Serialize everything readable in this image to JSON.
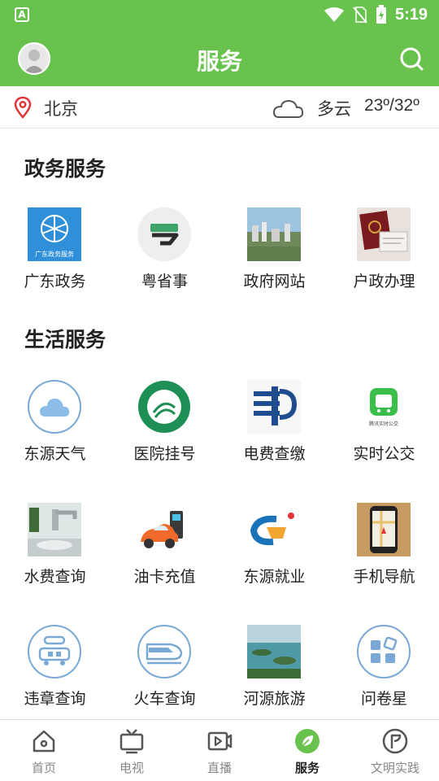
{
  "status": {
    "time": "5:19"
  },
  "header": {
    "title": "服务"
  },
  "weather": {
    "city": "北京",
    "condition": "多云",
    "temperature": "23º/32º"
  },
  "gov": {
    "title": "政务服务",
    "items": [
      {
        "label": "广东政务",
        "icon": "guangdong-gov-icon",
        "caption": "广东政务服务"
      },
      {
        "label": "粤省事",
        "icon": "yueshengshi-icon"
      },
      {
        "label": "政府网站",
        "icon": "city-photo-icon"
      },
      {
        "label": "户政办理",
        "icon": "passport-photo-icon"
      }
    ]
  },
  "life": {
    "title": "生活服务",
    "items": [
      {
        "label": "东源天气",
        "icon": "cloud-icon"
      },
      {
        "label": "医院挂号",
        "icon": "hospital-logo-icon"
      },
      {
        "label": "电费查缴",
        "icon": "power-grid-logo-icon"
      },
      {
        "label": "实时公交",
        "icon": "bus-app-icon",
        "caption": "腾讯实时公交"
      },
      {
        "label": "水费查询",
        "icon": "faucet-photo-icon"
      },
      {
        "label": "油卡充值",
        "icon": "car-fuel-icon"
      },
      {
        "label": "东源就业",
        "icon": "employment-logo-icon"
      },
      {
        "label": "手机导航",
        "icon": "phone-map-icon"
      },
      {
        "label": "违章查询",
        "icon": "traffic-car-icon"
      },
      {
        "label": "火车查询",
        "icon": "train-icon"
      },
      {
        "label": "河源旅游",
        "icon": "lake-photo-icon"
      },
      {
        "label": "问卷星",
        "icon": "survey-icon"
      }
    ]
  },
  "nav": [
    {
      "label": "首页",
      "icon": "home-icon"
    },
    {
      "label": "电视",
      "icon": "tv-icon"
    },
    {
      "label": "直播",
      "icon": "live-video-icon"
    },
    {
      "label": "服务",
      "icon": "leaf-service-icon",
      "active": true
    },
    {
      "label": "文明实践",
      "icon": "flag-circle-icon"
    }
  ],
  "colors": {
    "brand": "#6ac24e",
    "icon_outline": "#7aa9d6"
  }
}
